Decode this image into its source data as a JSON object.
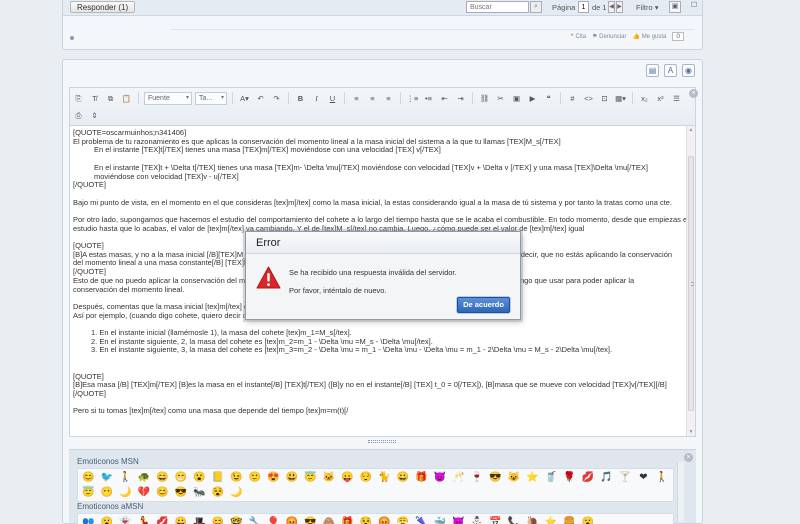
{
  "topbar": {
    "reply_button": "Responder (1)",
    "search_placeholder": "Buscar",
    "page_label": "Página",
    "page_value": "1",
    "page_of": "de 1",
    "filter_label": "Filtro"
  },
  "post_actions": {
    "quote": "Cita",
    "report": "Denunciar",
    "like": "Me gusta",
    "like_count": "0"
  },
  "toolbar": {
    "font_dropdown": "Fuente",
    "size_dropdown": "Ta..."
  },
  "editor": {
    "lines": [
      {
        "type": "ln",
        "text": "[QUOTE=oscarmuinhos;n341406]"
      },
      {
        "type": "ln",
        "text": "El problema de tu razonamiento es que aplicas la conservación del momento lineal a la masa inicial del sistema a la que tu llamas [TEX]M_s[/TEX]"
      },
      {
        "type": "ind",
        "text": "En el instante [TEX]t[/TEX] tienes una masa [TEX]m[/TEX] moviéndose con una velocidad [TEX] v[/TEX]"
      },
      {
        "type": "gap",
        "text": ""
      },
      {
        "type": "ind",
        "text": "En el instante [TEX]t + \\Delta t[/TEX] tienes una masa [TEX]m- \\Delta \\mu[/TEX] moviéndose con velocidad [TEX]v + \\Delta v [/TEX] y una masa [TEX]\\Delta \\mu[/TEX] moviéndose con velocidad [TEX]v - u[/TEX]"
      },
      {
        "type": "ln",
        "text": "[/QUOTE]"
      },
      {
        "type": "gap",
        "text": ""
      },
      {
        "type": "ln",
        "text": "Bajo mi punto de vista, en el momento en el que consideras [tex]m[/tex] como la masa inicial, la estas considerando igual a la masa de tú sistema y por tanto la tratas como una cte."
      },
      {
        "type": "gap",
        "text": ""
      },
      {
        "type": "ln",
        "text": "Por otro lado, supongamos que hacemos el estudio del comportamiento del cohete a lo largo del tiempo hasta que se le acaba el combustible. En todo momento, desde que empiezas el"
      },
      {
        "type": "ln",
        "text": "estudio hasta que lo acabas, el valor de [tex]m[/tex] va cambiando. Y el de [tex]M_s[/tex] no cambia. Luego, ¿cómo puede ser el valor de [tex]m[/tex] igual"
      },
      {
        "type": "gap",
        "text": ""
      },
      {
        "type": "ln",
        "text": "[QUOTE]"
      },
      {
        "type": "ln",
        "text": "[B]A estas masas, y no a la masa inicial [/B][TEX]M_s[/TEX] es a las que se aplica el principio de conservación del momento lineal. Es decir, que no estás aplicando la conservación"
      },
      {
        "type": "ln",
        "text": "del momento lineal a una masa constante[/B] [TEX]M_s[/TEX]"
      },
      {
        "type": "ln",
        "text": "[/QUOTE]"
      },
      {
        "type": "ln",
        "text": "Esto de que no puedo aplicar la conservación del momento lineal a una masa constante no lo entiendo, porque es la masa total que tengo que usar para poder aplicar la"
      },
      {
        "type": "ln",
        "text": "conservación del momento lineal."
      },
      {
        "type": "gap",
        "text": ""
      },
      {
        "type": "ln",
        "text": "Después, comentas que la masa inicial [tex]m[/tex] es constante en el tiempo"
      },
      {
        "type": "ln",
        "text": "Así por ejemplo, (cuando digo cohete, quiero decir combustible + carcasa):"
      },
      {
        "type": "gap",
        "text": ""
      },
      {
        "type": "ol",
        "text": "1. En el instante inicial (llamémosle 1), la masa del cohete [tex]m_1=M_s[/tex]."
      },
      {
        "type": "ol",
        "text": "2. En el instante siguiente, 2, la masa del cohete es [tex]m_2=m_1 - \\Delta \\mu =M_s - \\Delta \\mu[/tex]."
      },
      {
        "type": "ol",
        "text": "3. En el instante siguiente, 3, la masa del cohete es [tex]m_3=m_2 - \\Delta \\mu = m_1 - \\Delta \\mu - \\Delta \\mu = m_1 - 2\\Delta \\mu = M_s - 2\\Delta \\mu[/tex]."
      },
      {
        "type": "gap",
        "text": ""
      },
      {
        "type": "gap",
        "text": ""
      },
      {
        "type": "ln",
        "text": "[QUOTE]"
      },
      {
        "type": "ln",
        "text": "[B]Esa masa [/B] [TEX]m[/TEX] [B]es la masa en el instante[/B] [TEX]t[/TEX] ([B]y no en el instante[/B] [TEX] t_0 = 0[/TEX]), [B]masa que se mueve con velocidad [TEX]v[/TEX][/B]"
      },
      {
        "type": "ln",
        "text": "[/QUOTE]"
      },
      {
        "type": "gap",
        "text": ""
      },
      {
        "type": "ln",
        "text": "Pero si tu tomas [tex]m[/tex] como una masa que depende del tiempo [tex]m=m(t)[/"
      }
    ]
  },
  "emoticons": {
    "msn_title": "Emoticonos MSN",
    "msn_icons": [
      "😊",
      "🐦",
      "🚶",
      "🐢",
      "😄",
      "😁",
      "😮",
      "📒",
      "😉",
      "🙂",
      "😍",
      "😃",
      "😇",
      "🐱",
      "😛",
      "😌",
      "🐈",
      "😀",
      "🎁",
      "😈",
      "🥂",
      "🍷",
      "😎",
      "😺",
      "⭐",
      "🥤",
      "🌹",
      "💋",
      "🎵",
      "🍸",
      "❤",
      "🚶",
      "😇",
      "😶",
      "🌙",
      "💔",
      "😊",
      "😎",
      "🐜",
      "😵",
      "🌙"
    ],
    "amsn_title": "Emoticonos aMSN",
    "amsn_icons": [
      "👥",
      "😮",
      "👻",
      "💃",
      "💋",
      "😀",
      "🎩",
      "😊",
      "🤓",
      "🔧",
      "🎈",
      "😡",
      "😎",
      "🙈",
      "🎁",
      "😵",
      "😡",
      "😤",
      "🌂",
      "🐳",
      "😈",
      "⛄",
      "📅",
      "📞",
      "🐌",
      "⭐",
      "🍔",
      "😮"
    ]
  },
  "dialog": {
    "title": "Error",
    "message": "Se ha recibido una respuesta inválida del servidor.",
    "message2": "Por favor, inténtalo de nuevo.",
    "ok_button": "De acuerdo"
  }
}
